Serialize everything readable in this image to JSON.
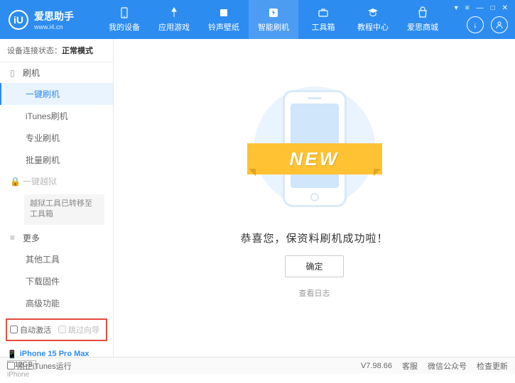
{
  "header": {
    "logo_text": "爱思助手",
    "logo_sub": "www.i4.cn",
    "logo_letter": "iU",
    "nav": [
      {
        "label": "我的设备",
        "icon": "device"
      },
      {
        "label": "应用游戏",
        "icon": "app"
      },
      {
        "label": "铃声壁纸",
        "icon": "ringtone"
      },
      {
        "label": "智能刷机",
        "icon": "flash",
        "active": true
      },
      {
        "label": "工具箱",
        "icon": "tools"
      },
      {
        "label": "教程中心",
        "icon": "tutorial"
      },
      {
        "label": "爱思商城",
        "icon": "mall"
      }
    ]
  },
  "sidebar": {
    "status_label": "设备连接状态：",
    "status_mode": "正常模式",
    "flash_section": "刷机",
    "items": {
      "one_key": "一键刷机",
      "itunes": "iTunes刷机",
      "pro": "专业刷机",
      "batch": "批量刷机"
    },
    "jailbreak_section": "一键越狱",
    "jailbreak_note": "越狱工具已转移至工具箱",
    "more_section": "更多",
    "more": {
      "other_tools": "其他工具",
      "download_fw": "下载固件",
      "advanced": "高级功能"
    },
    "checkbox1": "自动激活",
    "checkbox2": "跳过向导",
    "device": {
      "name": "iPhone 15 Pro Max",
      "capacity": "512GB",
      "type": "iPhone"
    }
  },
  "main": {
    "ribbon": "NEW",
    "success": "恭喜您，保资料刷机成功啦！",
    "ok": "确定",
    "log": "查看日志"
  },
  "footer": {
    "block_itunes": "阻止iTunes运行",
    "version": "V7.98.66",
    "service": "客服",
    "wechat": "微信公众号",
    "update": "检查更新"
  }
}
